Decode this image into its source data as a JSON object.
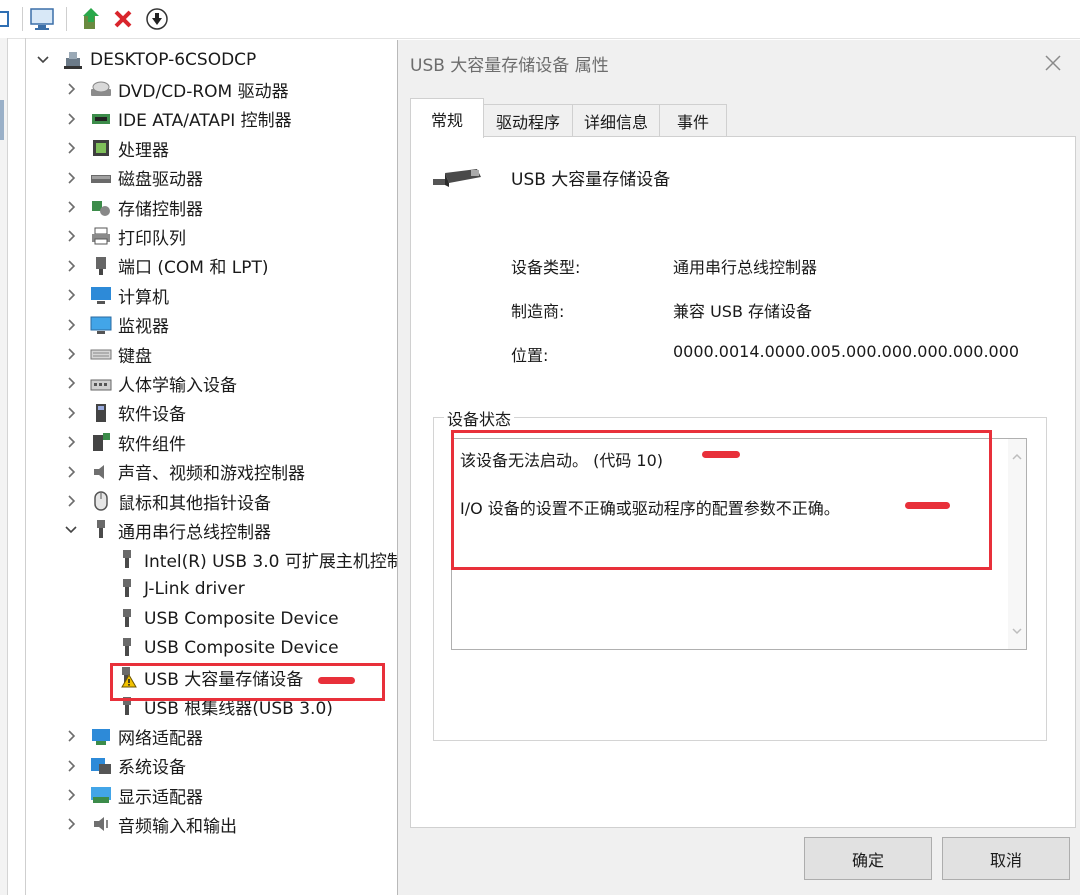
{
  "tree": {
    "root": "DESKTOP-6CSODCP",
    "categories": [
      {
        "label": "DVD/CD-ROM 驱动器",
        "icon": "disc-drive-icon"
      },
      {
        "label": "IDE ATA/ATAPI 控制器",
        "icon": "ide-controller-icon"
      },
      {
        "label": "处理器",
        "icon": "processor-icon"
      },
      {
        "label": "磁盘驱动器",
        "icon": "disk-drive-icon"
      },
      {
        "label": "存储控制器",
        "icon": "storage-controller-icon"
      },
      {
        "label": "打印队列",
        "icon": "printer-icon"
      },
      {
        "label": "端口 (COM 和 LPT)",
        "icon": "port-icon"
      },
      {
        "label": "计算机",
        "icon": "computer-icon"
      },
      {
        "label": "监视器",
        "icon": "monitor-icon"
      },
      {
        "label": "键盘",
        "icon": "keyboard-icon"
      },
      {
        "label": "人体学输入设备",
        "icon": "hid-icon"
      },
      {
        "label": "软件设备",
        "icon": "software-device-icon"
      },
      {
        "label": "软件组件",
        "icon": "software-component-icon"
      },
      {
        "label": "声音、视频和游戏控制器",
        "icon": "speaker-icon"
      },
      {
        "label": "鼠标和其他指针设备",
        "icon": "mouse-icon"
      }
    ],
    "usb_category": "通用串行总线控制器",
    "usb_children": [
      {
        "label": "Intel(R) USB 3.0 可扩展主机控制",
        "warning": false
      },
      {
        "label": "J-Link driver",
        "warning": false
      },
      {
        "label": "USB Composite Device",
        "warning": false
      },
      {
        "label": "USB Composite Device",
        "warning": false
      },
      {
        "label": "USB 大容量存储设备",
        "warning": true
      },
      {
        "label": "USB 根集线器(USB 3.0)",
        "warning": false
      }
    ],
    "after_categories": [
      {
        "label": "网络适配器",
        "icon": "network-adapter-icon"
      },
      {
        "label": "系统设备",
        "icon": "system-device-icon"
      },
      {
        "label": "显示适配器",
        "icon": "display-adapter-icon"
      },
      {
        "label": "音频输入和输出",
        "icon": "audio-io-icon"
      }
    ]
  },
  "dialog": {
    "title": "USB 大容量存储设备 属性",
    "tabs": [
      "常规",
      "驱动程序",
      "详细信息",
      "事件"
    ],
    "device_name": "USB 大容量存储设备",
    "device_type_label": "设备类型:",
    "device_type_value": "通用串行总线控制器",
    "manufacturer_label": "制造商:",
    "manufacturer_value": "兼容 USB 存储设备",
    "location_label": "位置:",
    "location_value": "0000.0014.0000.005.000.000.000.000.000",
    "status_group_title": "设备状态",
    "status_line1": "该设备无法启动。 (代码 10)",
    "status_line2": "I/O 设备的设置不正确或驱动程序的配置参数不正确。",
    "ok_label": "确定",
    "cancel_label": "取消"
  },
  "colors": {
    "annotation": "#e8303a",
    "dialog_bg": "#f0f0f0",
    "warning": "#f2c200"
  }
}
